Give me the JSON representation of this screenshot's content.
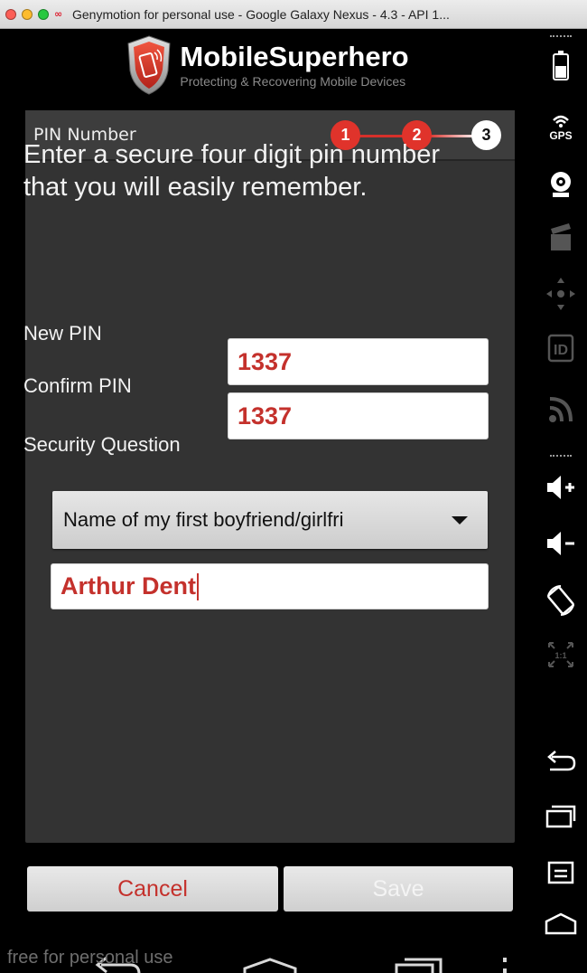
{
  "window": {
    "title": "Genymotion for personal use - Google Galaxy Nexus - 4.3 - API 1..."
  },
  "app": {
    "brand_name": "MobileSuperhero",
    "tagline": "Protecting & Recovering Mobile Devices"
  },
  "panel": {
    "title": "PIN Number",
    "steps": [
      "1",
      "2",
      "3"
    ],
    "current_step": 3,
    "instruction": "Enter a secure four digit pin number that you will easily remember."
  },
  "form": {
    "new_pin_label": "New PIN",
    "new_pin_value": "1337",
    "confirm_pin_label": "Confirm PIN",
    "confirm_pin_value": "1337",
    "security_question_label": "Security Question",
    "security_question_selected": "Name of my first boyfriend/girlfri",
    "security_answer_value": "Arthur Dent"
  },
  "buttons": {
    "cancel_label": "Cancel",
    "save_label": "Save"
  },
  "watermark": "free for personal use",
  "toolbar": {
    "gps_label": "GPS",
    "id_label": "ID",
    "scale_label": "1:1",
    "icons": [
      "battery-icon",
      "gps-icon",
      "webcam-icon",
      "screencast-icon",
      "dpad-icon",
      "id-icon",
      "rss-icon",
      "volume-up-icon",
      "volume-down-icon",
      "rotate-icon",
      "scale-icon",
      "back-icon",
      "recent-apps-icon",
      "menu-icon",
      "home-icon"
    ]
  },
  "colors": {
    "accent_red": "#e0332b",
    "input_text": "#c4312c",
    "panel_bg": "#333333"
  }
}
